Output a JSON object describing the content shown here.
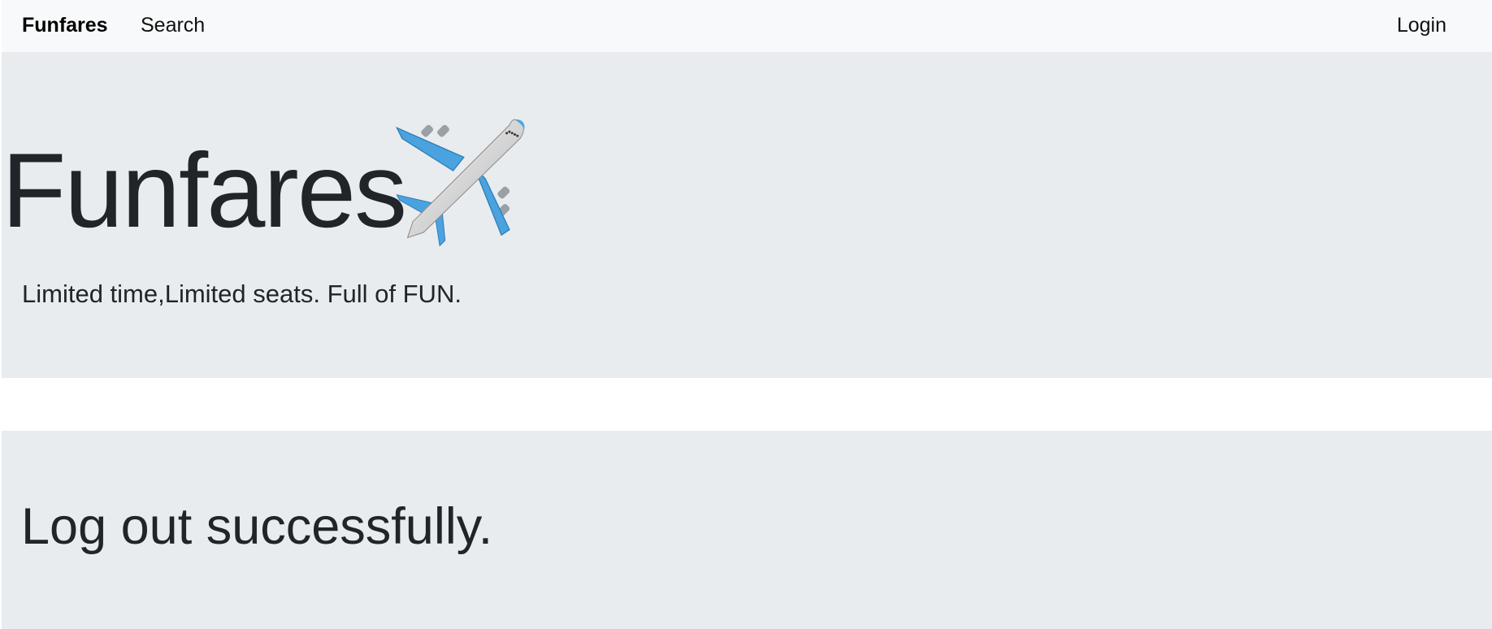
{
  "navbar": {
    "brand": "Funfares",
    "links": {
      "search": "Search",
      "login": "Login"
    }
  },
  "hero": {
    "title": "Funfares",
    "icon": "airplane-icon",
    "tagline": "Limited time,Limited seats. Full of FUN."
  },
  "message": {
    "text": "Log out successfully."
  },
  "colors": {
    "navbar_bg": "#f8f9fa",
    "panel_bg": "#e9ecef",
    "text": "#212529",
    "plane_blue": "#4aa3df"
  }
}
